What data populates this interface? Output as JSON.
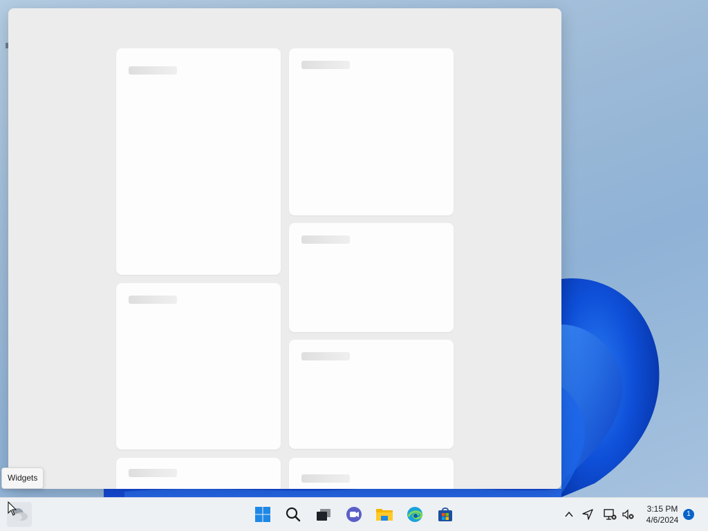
{
  "tooltip": {
    "text": "Widgets"
  },
  "taskbar": {
    "apps": [
      {
        "name": "start-button",
        "icon": "windows-logo-icon"
      },
      {
        "name": "search-button",
        "icon": "search-icon"
      },
      {
        "name": "task-view-button",
        "icon": "task-view-icon"
      },
      {
        "name": "chat-button",
        "icon": "chat-icon"
      },
      {
        "name": "file-explorer-button",
        "icon": "folder-icon"
      },
      {
        "name": "edge-button",
        "icon": "edge-icon"
      },
      {
        "name": "store-button",
        "icon": "store-icon"
      }
    ],
    "clock": {
      "time": "3:15 PM",
      "date": "4/6/2024"
    },
    "notification_count": "1"
  },
  "colors": {
    "accent": "#0a64c8",
    "board": "#ececec",
    "card": "#fdfdfd"
  }
}
